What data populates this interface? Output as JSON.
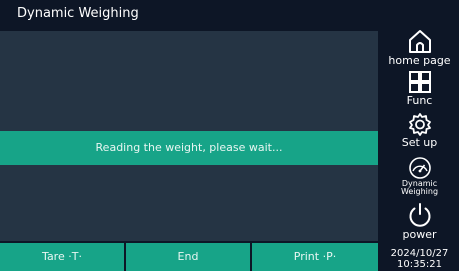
{
  "window": {
    "title": "Dynamic Weighing"
  },
  "main": {
    "message": "Reading the weight, please wait..."
  },
  "bottom_bar": {
    "tare_label": "Tare ·T·",
    "end_label": "End",
    "print_label": "Print ·P·"
  },
  "sidebar": {
    "home_label": "home page",
    "func_label": "Func",
    "setup_label": "Set up",
    "dynamic_line1": "Dynamic",
    "dynamic_line2": "Weighing",
    "power_label": "power",
    "date": "2024/10/27",
    "time": "10:35:21"
  },
  "colors": {
    "background": "#0d1626",
    "panel": "#253444",
    "accent": "#17a488",
    "text": "#ffffff"
  },
  "icons": [
    "home-icon",
    "func-grid-icon",
    "setup-gear-icon",
    "dynamic-gauge-icon",
    "power-icon"
  ]
}
